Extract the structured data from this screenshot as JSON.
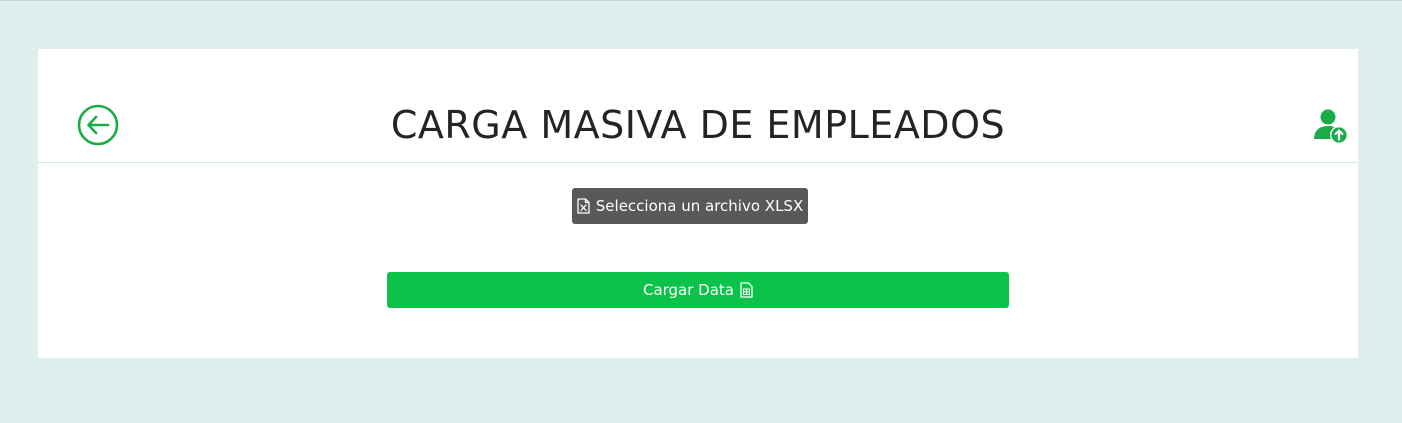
{
  "page": {
    "title": "CARGA MASIVA DE EMPLEADOS"
  },
  "actions": {
    "select_file_label": "Selecciona un archivo XLSX",
    "load_data_label": "Cargar Data"
  },
  "icons": {
    "back": "arrow-left-circle-icon",
    "user_upload": "user-upload-icon",
    "file_excel": "file-excel-icon",
    "file_spreadsheet": "file-spreadsheet-icon"
  },
  "colors": {
    "page_background": "#dfefed",
    "card_background": "#ffffff",
    "accent_green": "#0bc24a",
    "icon_green": "#1aad47",
    "file_button_gray": "#595959",
    "title_text": "#222426"
  }
}
